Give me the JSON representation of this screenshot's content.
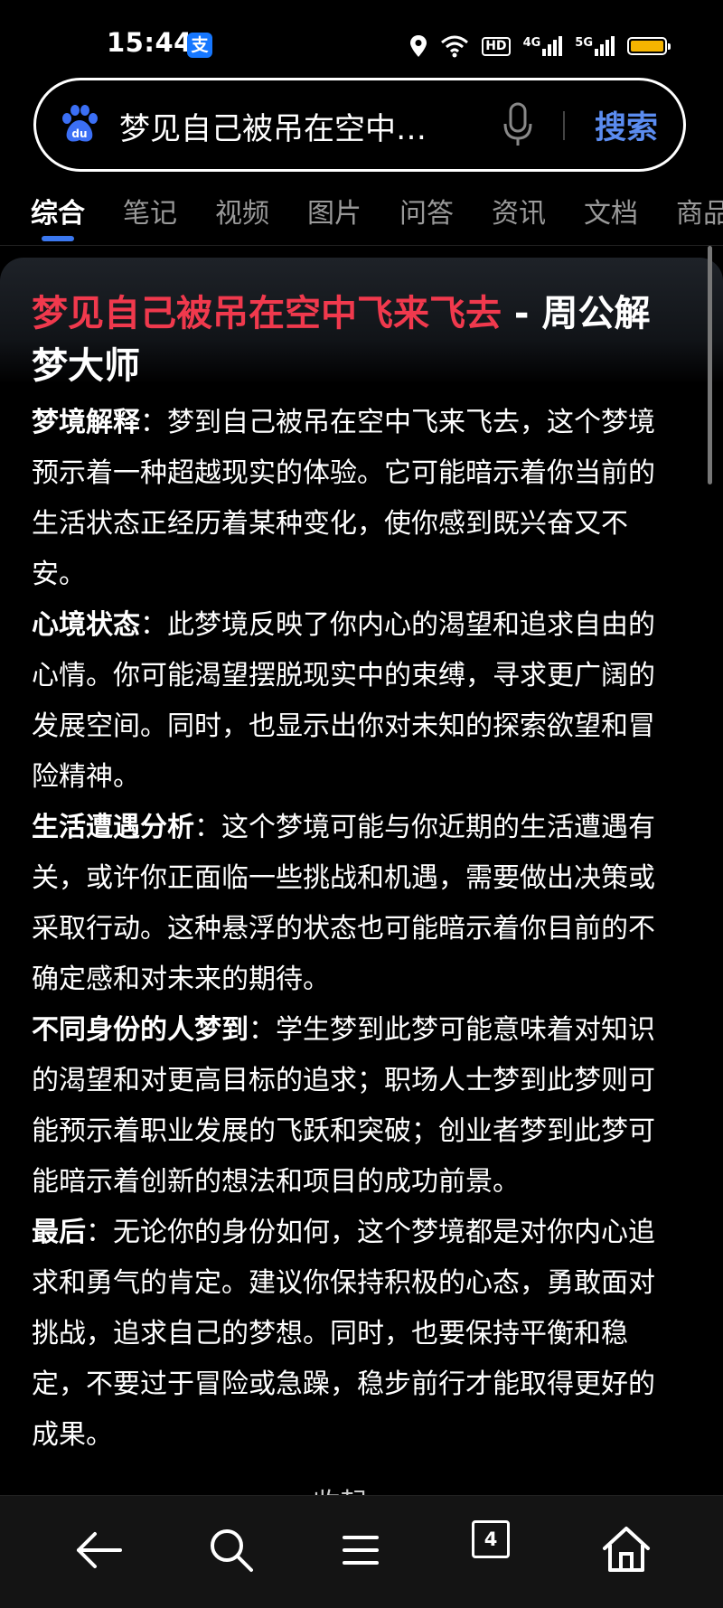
{
  "status_bar": {
    "time": "15:44",
    "app_badge": "支",
    "hd_label": "HD",
    "net1": "4G",
    "net2": "5G",
    "battery_color": "#f5b400"
  },
  "search": {
    "query": "梦见自己被吊在空中飞...",
    "button_label": "搜索"
  },
  "tabs": [
    {
      "label": "综合"
    },
    {
      "label": "笔记"
    },
    {
      "label": "视频"
    },
    {
      "label": "图片"
    },
    {
      "label": "问答"
    },
    {
      "label": "资讯"
    },
    {
      "label": "文档"
    },
    {
      "label": "商品"
    }
  ],
  "result": {
    "title_highlight": "梦见自己被吊在空中飞来飞去",
    "title_rest": " - 周公解梦大师",
    "sections": [
      {
        "heading": "梦境解释",
        "sep": "：",
        "text": "梦到自己被吊在空中飞来飞去，这个梦境预示着一种超越现实的体验。它可能暗示着你当前的生活状态正经历着某种变化，使你感到既兴奋又不安。"
      },
      {
        "heading": "心境状态",
        "sep": "：",
        "text": "此梦境反映了你内心的渴望和追求自由的心情。你可能渴望摆脱现实中的束缚，寻求更广阔的发展空间。同时，也显示出你对未知的探索欲望和冒险精神。"
      },
      {
        "heading": "生活遭遇分析",
        "sep": "：",
        "text": "这个梦境可能与你近期的生活遭遇有关，或许你正面临一些挑战和机遇，需要做出决策或采取行动。这种悬浮的状态也可能暗示着你目前的不确定感和对未来的期待。"
      },
      {
        "heading": "不同身份的人梦到",
        "sep": "：",
        "text": "学生梦到此梦可能意味着对知识的渴望和对更高目标的追求；职场人士梦到此梦则可能预示着职业发展的飞跃和突破；创业者梦到此梦可能暗示着创新的想法和项目的成功前景。"
      },
      {
        "heading": "最后",
        "sep": "：",
        "text": "无论你的身份如何，这个梦境都是对你内心追求和勇气的肯定。建议你保持积极的心态，勇敢面对挑战，追求自己的梦想。同时，也要保持平衡和稳定，不要过于冒险或急躁，稳步前行才能取得更好的成果。"
      }
    ],
    "collapse_label": "收起"
  },
  "bottom_nav": {
    "tab_count": "4",
    "icons": [
      "back-arrow-icon",
      "search-icon",
      "menu-icon",
      "tabs-icon",
      "home-icon"
    ]
  }
}
